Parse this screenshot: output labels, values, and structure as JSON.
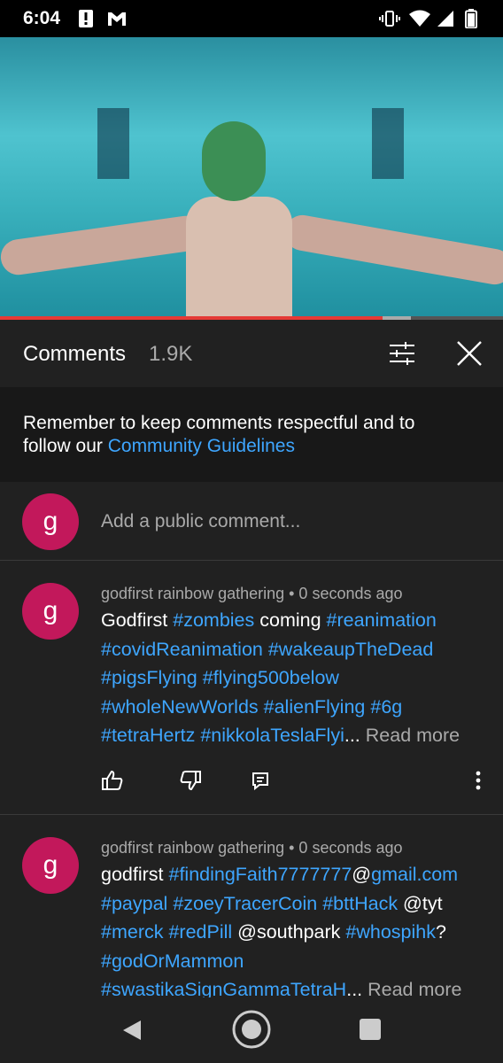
{
  "status_bar": {
    "time": "6:04",
    "icons": [
      "alert-icon",
      "gmail-icon",
      "vibrate-icon",
      "wifi-icon",
      "signal-icon",
      "battery-icon"
    ]
  },
  "video": {
    "progress_fraction": 0.76
  },
  "comments_header": {
    "title": "Comments",
    "count": "1.9K",
    "icons": [
      "filter-sliders-icon",
      "close-icon"
    ]
  },
  "notice": {
    "text": "Remember to keep comments respectful and to follow our ",
    "link": "Community Guidelines"
  },
  "add_comment": {
    "avatar_letter": "g",
    "placeholder": "Add a public comment..."
  },
  "comments": [
    {
      "avatar_letter": "g",
      "author_time": "godfirst rainbow gathering • 0 seconds ago",
      "segments": [
        {
          "t": "Godfirst ",
          "tag": false
        },
        {
          "t": "#zombies",
          "tag": true
        },
        {
          "t": " coming ",
          "tag": false
        },
        {
          "t": "#reanimation",
          "tag": true
        },
        {
          "t": " ",
          "tag": false
        },
        {
          "t": "#covidReanimation",
          "tag": true
        },
        {
          "t": " ",
          "tag": false
        },
        {
          "t": "#wakeaupTheDead",
          "tag": true
        },
        {
          "t": " ",
          "tag": false
        },
        {
          "t": "#pigsFlying",
          "tag": true
        },
        {
          "t": " ",
          "tag": false
        },
        {
          "t": "#flying500below",
          "tag": true
        },
        {
          "t": " ",
          "tag": false
        },
        {
          "t": "#wholeNewWorlds",
          "tag": true
        },
        {
          "t": " ",
          "tag": false
        },
        {
          "t": "#alienFlying",
          "tag": true
        },
        {
          "t": " ",
          "tag": false
        },
        {
          "t": "#6g",
          "tag": true
        },
        {
          "t": " ",
          "tag": false
        },
        {
          "t": "#tetraHertz",
          "tag": true
        },
        {
          "t": " ",
          "tag": false
        },
        {
          "t": "#nikkolaTeslaFlyi",
          "tag": true
        },
        {
          "t": "...",
          "tag": false
        }
      ],
      "read_more": " Read more",
      "actions": [
        "like-icon",
        "dislike-icon",
        "reply-icon",
        "more-vert-icon"
      ]
    },
    {
      "avatar_letter": "g",
      "author_time": "godfirst rainbow gathering • 0 seconds ago",
      "segments": [
        {
          "t": "godfirst ",
          "tag": false
        },
        {
          "t": "#findingFaith7777777",
          "tag": true
        },
        {
          "t": "@",
          "tag": false
        },
        {
          "t": "gmail.com",
          "tag": true
        },
        {
          "t": " ",
          "tag": false
        },
        {
          "t": "#paypal",
          "tag": true
        },
        {
          "t": " ",
          "tag": false
        },
        {
          "t": "#zoeyTracerCoin",
          "tag": true
        },
        {
          "t": " ",
          "tag": false
        },
        {
          "t": "#bttHack",
          "tag": true
        },
        {
          "t": " @tyt ",
          "tag": false
        },
        {
          "t": "#merck",
          "tag": true
        },
        {
          "t": " ",
          "tag": false
        },
        {
          "t": "#redPill",
          "tag": true
        },
        {
          "t": " @southpark ",
          "tag": false
        },
        {
          "t": "#whospihk",
          "tag": true
        },
        {
          "t": "? ",
          "tag": false
        },
        {
          "t": "#godOrMammon",
          "tag": true
        },
        {
          "t": " ",
          "tag": false
        },
        {
          "t": "#swastikaSignGammaTetraH",
          "tag": true
        },
        {
          "t": "...",
          "tag": false
        }
      ],
      "read_more": " Read more"
    }
  ],
  "nav_bar": {
    "buttons": [
      "back-icon",
      "home-icon",
      "recents-icon"
    ]
  },
  "colors": {
    "accent_link": "#3ea6ff",
    "avatar": "#c2185b",
    "progress": "#e53935",
    "background": "#212121"
  }
}
